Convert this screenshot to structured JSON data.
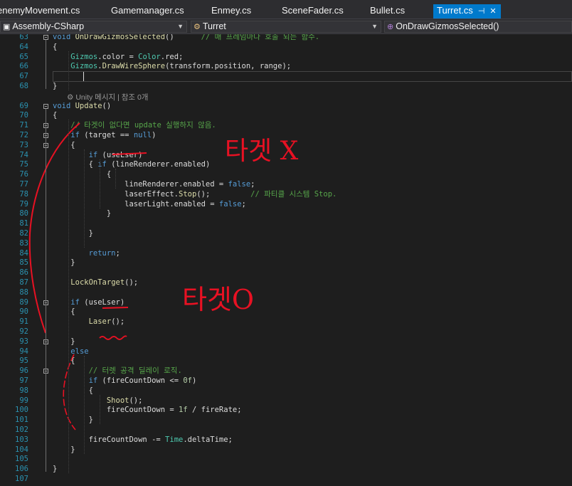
{
  "tabs": [
    {
      "label": "enemyMovement.cs",
      "active": false
    },
    {
      "label": "Gamemanager.cs",
      "active": false
    },
    {
      "label": "Enmey.cs",
      "active": false
    },
    {
      "label": "SceneFader.cs",
      "active": false
    },
    {
      "label": "Bullet.cs",
      "active": false
    },
    {
      "label": "Turret.cs",
      "active": true
    }
  ],
  "tab_pin_glyph": "⊣",
  "tab_close_glyph": "✕",
  "nav": {
    "project": "Assembly-CSharp",
    "class": "Turret",
    "member": "OnDrawGizmosSelected()",
    "project_icon": "csharp-project-icon",
    "class_icon": "class-icon",
    "member_icon": "method-icon"
  },
  "code_lens": "⚙ Unity 메시지 | 참조 0개",
  "lines": [
    {
      "n": "63",
      "segs": [
        [
          "kw",
          "void "
        ],
        [
          "mt",
          "OnDrawGizmosSelected"
        ],
        [
          "",
          "()      "
        ],
        [
          "cm",
          "// 매 프레임마다 호출 되는 함수."
        ]
      ]
    },
    {
      "n": "64",
      "segs": [
        [
          "",
          "{"
        ]
      ]
    },
    {
      "n": "65",
      "segs": [
        [
          "",
          "    "
        ],
        [
          "ty",
          "Gizmos"
        ],
        [
          "",
          "."
        ],
        [
          "",
          "color = "
        ],
        [
          "ty",
          "Color"
        ],
        [
          "",
          ".red;"
        ]
      ]
    },
    {
      "n": "66",
      "segs": [
        [
          "",
          "    "
        ],
        [
          "ty",
          "Gizmos"
        ],
        [
          "",
          "."
        ],
        [
          "mt",
          "DrawWireSphere"
        ],
        [
          "",
          "(transform.position, range);"
        ]
      ]
    },
    {
      "n": "67",
      "segs": [
        [
          "",
          ""
        ]
      ]
    },
    {
      "n": "68",
      "segs": [
        [
          "",
          "}"
        ]
      ]
    },
    {
      "n": "69",
      "segs": [
        [
          "kw",
          "void "
        ],
        [
          "mt",
          "Update"
        ],
        [
          "",
          "()"
        ]
      ]
    },
    {
      "n": "70",
      "segs": [
        [
          "",
          "{"
        ]
      ]
    },
    {
      "n": "71",
      "segs": [
        [
          "",
          "    "
        ],
        [
          "cm",
          "// 타겟이 없다면 update 실행하지 않음."
        ]
      ]
    },
    {
      "n": "72",
      "segs": [
        [
          "",
          "    "
        ],
        [
          "kw",
          "if"
        ],
        [
          "",
          " (target == "
        ],
        [
          "kw",
          "null"
        ],
        [
          "",
          ")"
        ]
      ]
    },
    {
      "n": "73",
      "segs": [
        [
          "",
          "    {"
        ]
      ]
    },
    {
      "n": "74",
      "segs": [
        [
          "",
          "        "
        ],
        [
          "kw",
          "if"
        ],
        [
          "",
          " (useLser)"
        ]
      ]
    },
    {
      "n": "75",
      "segs": [
        [
          "",
          "        { "
        ],
        [
          "kw",
          "if"
        ],
        [
          "",
          " (lineRenderer.enabled)"
        ]
      ]
    },
    {
      "n": "76",
      "segs": [
        [
          "",
          "            {"
        ]
      ]
    },
    {
      "n": "77",
      "segs": [
        [
          "",
          "                lineRenderer.enabled = "
        ],
        [
          "kw",
          "false"
        ],
        [
          "",
          ";"
        ]
      ]
    },
    {
      "n": "78",
      "segs": [
        [
          "",
          "                laserEffect."
        ],
        [
          "mt",
          "Stop"
        ],
        [
          "",
          "();         "
        ],
        [
          "cm",
          "// 파티클 시스템 Stop."
        ]
      ]
    },
    {
      "n": "79",
      "segs": [
        [
          "",
          "                laserLight.enabled = "
        ],
        [
          "kw",
          "false"
        ],
        [
          "",
          ";"
        ]
      ]
    },
    {
      "n": "80",
      "segs": [
        [
          "",
          "            }"
        ]
      ]
    },
    {
      "n": "81",
      "segs": [
        [
          "",
          ""
        ]
      ]
    },
    {
      "n": "82",
      "segs": [
        [
          "",
          "        }"
        ]
      ]
    },
    {
      "n": "83",
      "segs": [
        [
          "",
          ""
        ]
      ]
    },
    {
      "n": "84",
      "segs": [
        [
          "",
          "        "
        ],
        [
          "kw",
          "return"
        ],
        [
          "",
          ";"
        ]
      ]
    },
    {
      "n": "85",
      "segs": [
        [
          "",
          "    }"
        ]
      ]
    },
    {
      "n": "86",
      "segs": [
        [
          "",
          ""
        ]
      ]
    },
    {
      "n": "87",
      "segs": [
        [
          "",
          "    "
        ],
        [
          "mt",
          "LockOnTarget"
        ],
        [
          "",
          "();"
        ]
      ]
    },
    {
      "n": "88",
      "segs": [
        [
          "",
          ""
        ]
      ]
    },
    {
      "n": "89",
      "segs": [
        [
          "",
          "    "
        ],
        [
          "kw",
          "if"
        ],
        [
          "",
          " (useLser)"
        ]
      ]
    },
    {
      "n": "90",
      "segs": [
        [
          "",
          "    {"
        ]
      ]
    },
    {
      "n": "91",
      "segs": [
        [
          "",
          "        "
        ],
        [
          "mt",
          "Laser"
        ],
        [
          "",
          "();"
        ]
      ]
    },
    {
      "n": "92",
      "segs": [
        [
          "",
          ""
        ]
      ]
    },
    {
      "n": "93",
      "segs": [
        [
          "",
          "    }"
        ]
      ]
    },
    {
      "n": "94",
      "segs": [
        [
          "",
          "    "
        ],
        [
          "kw",
          "else"
        ]
      ]
    },
    {
      "n": "95",
      "segs": [
        [
          "",
          "    {"
        ]
      ]
    },
    {
      "n": "96",
      "segs": [
        [
          "",
          "        "
        ],
        [
          "cm",
          "// 터렛 공격 딜레이 로직."
        ]
      ]
    },
    {
      "n": "97",
      "segs": [
        [
          "",
          "        "
        ],
        [
          "kw",
          "if"
        ],
        [
          "",
          " (fireCountDown <= "
        ],
        [
          "nm",
          "0f"
        ],
        [
          "",
          ")"
        ]
      ]
    },
    {
      "n": "98",
      "segs": [
        [
          "",
          "        {"
        ]
      ]
    },
    {
      "n": "99",
      "segs": [
        [
          "",
          "            "
        ],
        [
          "mt",
          "Shoot"
        ],
        [
          "",
          "();"
        ]
      ]
    },
    {
      "n": "100",
      "segs": [
        [
          "",
          "            fireCountDown = "
        ],
        [
          "nm",
          "1f"
        ],
        [
          "",
          " / fireRate;"
        ]
      ]
    },
    {
      "n": "101",
      "segs": [
        [
          "",
          "        }"
        ]
      ]
    },
    {
      "n": "102",
      "segs": [
        [
          "",
          ""
        ]
      ]
    },
    {
      "n": "103",
      "segs": [
        [
          "",
          "        fireCountDown -= "
        ],
        [
          "ty",
          "Time"
        ],
        [
          "",
          ".deltaTime;"
        ]
      ]
    },
    {
      "n": "104",
      "segs": [
        [
          "",
          "    }"
        ]
      ]
    },
    {
      "n": "105",
      "segs": [
        [
          "",
          ""
        ]
      ]
    },
    {
      "n": "106",
      "segs": [
        [
          "",
          "}"
        ]
      ]
    },
    {
      "n": "107",
      "segs": [
        [
          "",
          ""
        ]
      ]
    }
  ],
  "annotations": {
    "no_target": "타겟 X",
    "has_target": "타겟O"
  },
  "colors": {
    "background": "#1e1e1e",
    "keyword": "#569cd6",
    "type": "#4ec9b0",
    "comment": "#57a64a",
    "method": "#dcdcaa",
    "line_number": "#2b91af",
    "accent_tab": "#007acc",
    "ink": "#e81123"
  }
}
